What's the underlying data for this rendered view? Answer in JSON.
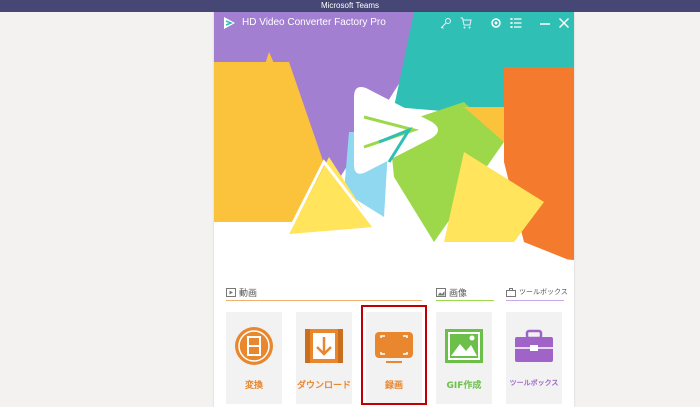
{
  "os_window": {
    "title": "Microsoft Teams"
  },
  "app": {
    "title": "HD Video Converter Factory Pro",
    "title_icons": [
      "key-icon",
      "cart-icon",
      "settings-icon",
      "menu-list-icon",
      "minimize-icon",
      "close-icon"
    ]
  },
  "sections": {
    "video": {
      "label": "動画",
      "icon": "video-section-icon"
    },
    "image": {
      "label": "画像",
      "icon": "image-section-icon"
    },
    "toolbox": {
      "label": "ツールボックス",
      "icon": "toolbox-section-icon"
    }
  },
  "tiles": [
    {
      "label": "変換",
      "icon": "film-reel-icon",
      "color": "#e8872e"
    },
    {
      "label": "ダウンロード",
      "icon": "download-icon",
      "color": "#e8872e"
    },
    {
      "label": "録画",
      "icon": "screen-record-icon",
      "color": "#e8872e",
      "highlighted": true
    },
    {
      "label": "GIF作成",
      "icon": "gif-image-icon",
      "color": "#6cc04a"
    },
    {
      "label": "ツールボックス",
      "icon": "toolbox-icon",
      "color": "#a064c8"
    }
  ],
  "colors": {
    "teams_bar": "#464775",
    "purple": "#a37fd2",
    "teal": "#2fbfb5",
    "yellow": "#fbc33b",
    "orange": "#f47a2d",
    "green": "#9dd84a",
    "light_blue": "#8fd8f0",
    "highlight_border": "#c00000"
  }
}
